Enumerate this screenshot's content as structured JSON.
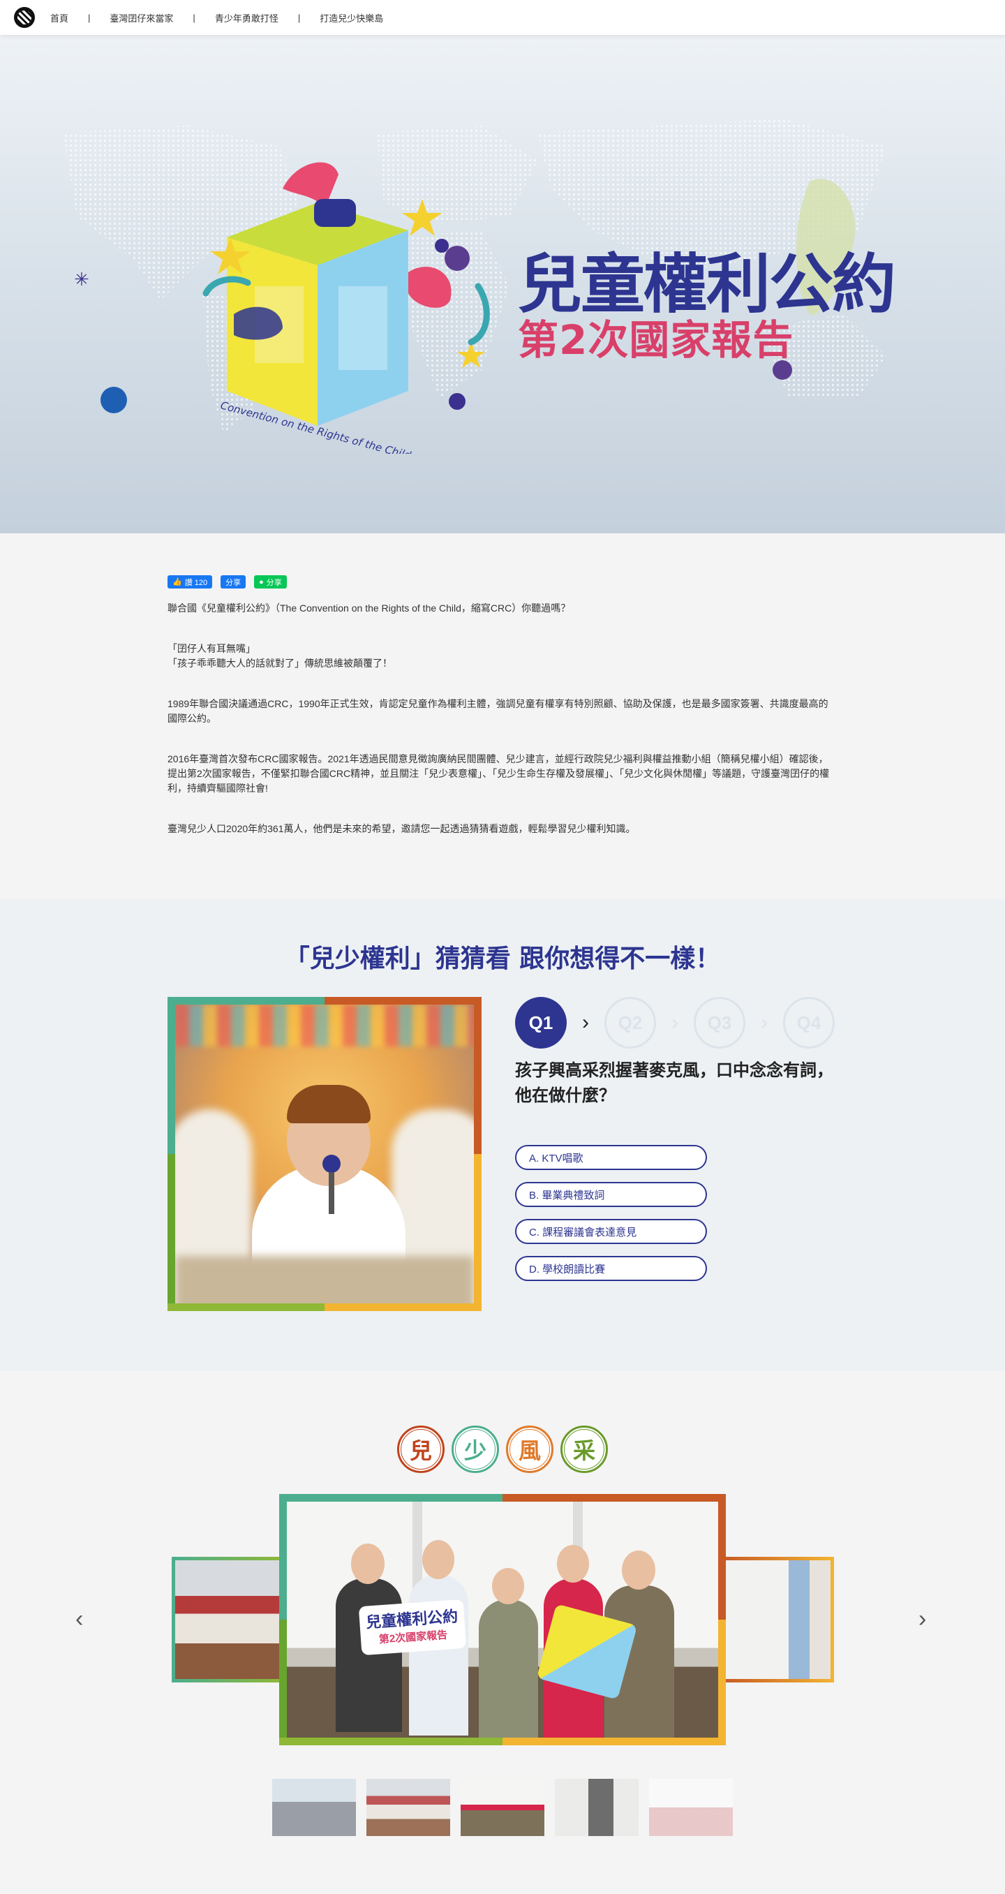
{
  "nav": {
    "items": [
      "首頁",
      "臺灣囝仔來當家",
      "青少年勇敢打怪",
      "打造兒少快樂島"
    ],
    "separator": "|"
  },
  "hero": {
    "title": "兒童權利公約",
    "subtitle": "第2次國家報告",
    "logo_text": "Convention on the Rights of the Child"
  },
  "social": {
    "like_label": "讚 120",
    "share_label": "分享",
    "line_label": "分享"
  },
  "intro": {
    "p1": "聯合國《兒童權利公約》（The Convention on the Rights of the Child，縮寫CRC）你聽過嗎？",
    "p2a": "「囝仔人有耳無嘴」",
    "p2b": "「孩子乖乖聽大人的話就對了」傳統思維被顛覆了！",
    "p3": "1989年聯合國決議通過CRC，1990年正式生效，肯認定兒童作為權利主體，強調兒童有權享有特別照顧、協助及保護，也是最多國家簽署、共識度最高的國際公約。",
    "p4": "2016年臺灣首次發布CRC國家報告。2021年透過民間意見徵詢廣納民間團體、兒少建言，並經行政院兒少福利與權益推動小組（簡稱兒權小組）確認後，提出第2次國家報告，不僅緊扣聯合國CRC精神，並且關注「兒少表意權」、「兒少生命生存權及發展權」、「兒少文化與休閒權」等議題，守護臺灣囝仔的權利，持續齊驅國際社會!",
    "p5": "臺灣兒少人口2020年約361萬人，他們是未來的希望，邀請您一起透過猜猜看遊戲，輕鬆學習兒少權利知識。"
  },
  "quiz": {
    "heading": "「兒少權利」猜猜看 跟你想得不一樣！",
    "steps": [
      "Q1",
      "Q2",
      "Q3",
      "Q4"
    ],
    "active_step": 1,
    "question": "孩子興高采烈握著麥克風，口中念念有詞，他在做什麼？",
    "options": [
      "A. KTV唱歌",
      "B. 畢業典禮致詞",
      "C. 課程審議會表達意見",
      "D. 學校朗讀比賽"
    ]
  },
  "gallery": {
    "badges": [
      {
        "char": "兒",
        "color": "#c0441c"
      },
      {
        "char": "少",
        "color": "#4cae8e"
      },
      {
        "char": "風",
        "color": "#e07a2a"
      },
      {
        "char": "采",
        "color": "#6a9a2a"
      }
    ],
    "prev": "‹",
    "next": "›",
    "sign_text_1": "兒童權利公約",
    "sign_text_2": "第2次國家報告",
    "thumbnail_count": 5,
    "selected_thumbnail": 3
  },
  "colors": {
    "brand_blue": "#2d3590",
    "brand_pink": "#d8406a",
    "frame_teal": "#4cae8e",
    "frame_orange": "#c85a25",
    "frame_green": "#8fb836",
    "frame_yellow": "#f2b431"
  }
}
